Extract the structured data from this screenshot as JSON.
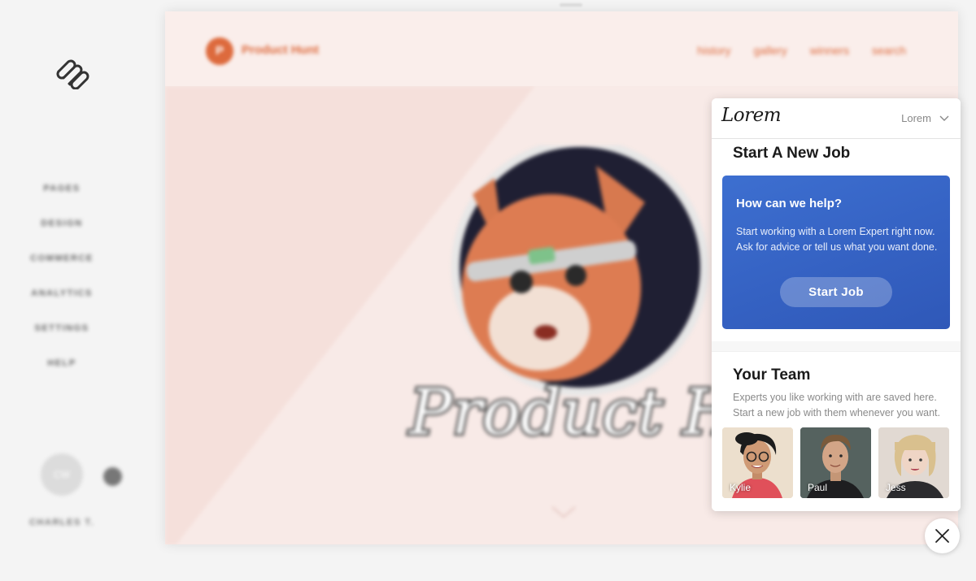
{
  "sidebar": {
    "logo": "squarespace-logo-icon",
    "nav_items": [
      "PAGES",
      "DESIGN",
      "COMMERCE",
      "ANALYTICS",
      "SETTINGS",
      "HELP"
    ],
    "avatar_initials": "CW",
    "user_name": "CHARLES T."
  },
  "preview": {
    "brand_name": "Product Hunt",
    "brand_initial": "P",
    "nav": [
      "history",
      "gallery",
      "winners",
      "search"
    ],
    "hero_script": "Product Hunt",
    "accent_color": "#dd6a3d"
  },
  "widget": {
    "logo": "Lorem",
    "dropdown_label": "Lorem",
    "new_job": {
      "title": "Start A New Job",
      "card_title": "How can we help?",
      "card_text": "Start working with a Lorem Expert right now. Ask for advice or tell us what you want done.",
      "button_label": "Start Job"
    },
    "team": {
      "title": "Your Team",
      "description": "Experts you like working with are saved here. Start a new job with them whenever you want.",
      "members": [
        "Kylie",
        "Paul",
        "Jess"
      ]
    }
  },
  "colors": {
    "card_blue": "#3562c3",
    "preview_bg": "#f8e9e6"
  }
}
